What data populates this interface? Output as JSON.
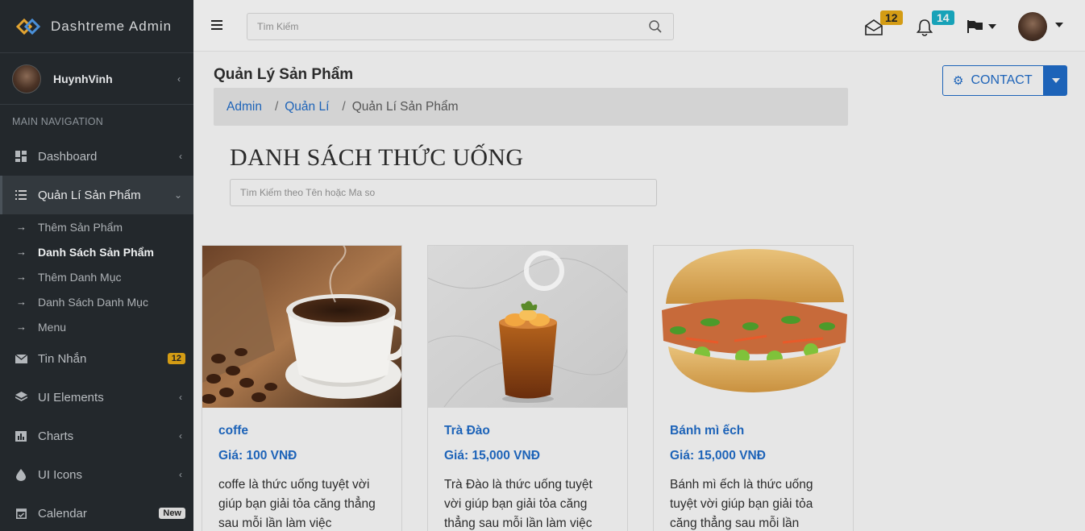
{
  "brand": {
    "name": "Dashtreme Admin"
  },
  "user": {
    "name": "HuynhVinh"
  },
  "sidebar": {
    "header": "MAIN NAVIGATION",
    "dashboard": "Dashboard",
    "products": "Quản Lí Sản Phẩm",
    "sub": [
      "Thêm Sản Phẩm",
      "Danh Sách Sản Phẩm",
      "Thêm Danh Mục",
      "Danh Sách Danh Mục",
      "Menu"
    ],
    "messages": "Tin Nhắn",
    "messages_badge": "12",
    "ui_elements": "UI Elements",
    "charts": "Charts",
    "ui_icons": "UI Icons",
    "calendar": "Calendar",
    "calendar_badge": "New"
  },
  "topbar": {
    "search_placeholder": "Tìm Kiếm",
    "mail_badge": "12",
    "bell_badge": "14"
  },
  "page": {
    "title": "Quản Lý Sản Phẩm",
    "breadcrumb": [
      "Admin",
      "Quản Lí",
      "Quản Lí Sản Phẩm"
    ],
    "contact": "CONTACT",
    "list_title": "DANH SÁCH THỨC UỐNG",
    "list_search_placeholder": "Tìm Kiếm theo Tên hoặc Ma so"
  },
  "products": [
    {
      "name": "coffe",
      "price": "Giá: 100 VNĐ",
      "desc": "coffe là thức uống tuyệt vời giúp bạn giải tỏa căng thẳng sau mỗi lần làm việc"
    },
    {
      "name": "Trà Đào",
      "price": "Giá: 15,000 VNĐ",
      "desc": "Trà Đào là thức uống tuyệt vời giúp bạn giải tỏa căng thẳng sau mỗi lần làm việc"
    },
    {
      "name": "Bánh mì ếch",
      "price": "Giá: 15,000 VNĐ",
      "desc": "Bánh mì ếch là thức uống tuyệt vời giúp bạn giải tỏa căng thẳng sau mỗi lần"
    }
  ],
  "colors": {
    "sidebar_bg": "#23282c",
    "accent": "#1d63b8",
    "badge_warn": "#d49c14",
    "badge_info": "#17a2b8"
  }
}
